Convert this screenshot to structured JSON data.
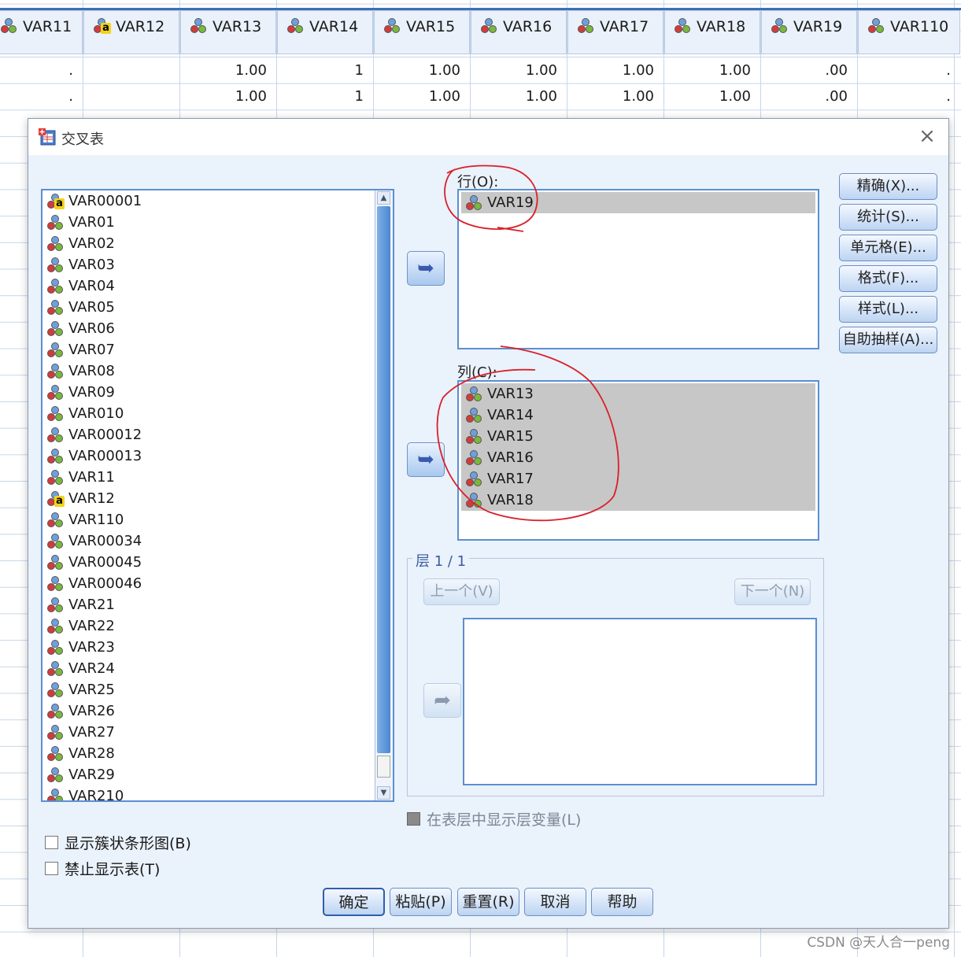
{
  "spreadsheet": {
    "columns": [
      "VAR11",
      "VAR12",
      "VAR13",
      "VAR14",
      "VAR15",
      "VAR16",
      "VAR17",
      "VAR18",
      "VAR19",
      "VAR110"
    ],
    "column_types": [
      "numeric",
      "string",
      "numeric",
      "numeric",
      "numeric",
      "numeric",
      "numeric",
      "numeric",
      "numeric",
      "numeric"
    ],
    "rows": [
      [
        ".",
        "",
        "1.00",
        "1",
        "1.00",
        "1.00",
        "1.00",
        "1.00",
        ".00",
        "."
      ],
      [
        ".",
        "",
        "1.00",
        "1",
        "1.00",
        "1.00",
        "1.00",
        "1.00",
        ".00",
        "."
      ]
    ]
  },
  "dialog": {
    "title": "交叉表",
    "close_symbol": "×",
    "variables": [
      {
        "label": "VAR00001",
        "type": "string"
      },
      {
        "label": "VAR01",
        "type": "numeric"
      },
      {
        "label": "VAR02",
        "type": "numeric"
      },
      {
        "label": "VAR03",
        "type": "numeric"
      },
      {
        "label": "VAR04",
        "type": "numeric"
      },
      {
        "label": "VAR05",
        "type": "numeric"
      },
      {
        "label": "VAR06",
        "type": "numeric"
      },
      {
        "label": "VAR07",
        "type": "numeric"
      },
      {
        "label": "VAR08",
        "type": "numeric"
      },
      {
        "label": "VAR09",
        "type": "numeric"
      },
      {
        "label": "VAR010",
        "type": "numeric"
      },
      {
        "label": "VAR00012",
        "type": "numeric"
      },
      {
        "label": "VAR00013",
        "type": "numeric"
      },
      {
        "label": "VAR11",
        "type": "numeric"
      },
      {
        "label": "VAR12",
        "type": "string"
      },
      {
        "label": "VAR110",
        "type": "numeric"
      },
      {
        "label": "VAR00034",
        "type": "numeric"
      },
      {
        "label": "VAR00045",
        "type": "numeric"
      },
      {
        "label": "VAR00046",
        "type": "numeric"
      },
      {
        "label": "VAR21",
        "type": "numeric"
      },
      {
        "label": "VAR22",
        "type": "numeric"
      },
      {
        "label": "VAR23",
        "type": "numeric"
      },
      {
        "label": "VAR24",
        "type": "numeric"
      },
      {
        "label": "VAR25",
        "type": "numeric"
      },
      {
        "label": "VAR26",
        "type": "numeric"
      },
      {
        "label": "VAR27",
        "type": "numeric"
      },
      {
        "label": "VAR28",
        "type": "numeric"
      },
      {
        "label": "VAR29",
        "type": "numeric"
      },
      {
        "label": "VAR210",
        "type": "numeric"
      }
    ],
    "rows_label": "行(O):",
    "rows_items": [
      "VAR19"
    ],
    "columns_label": "列(C):",
    "columns_items": [
      "VAR13",
      "VAR14",
      "VAR15",
      "VAR16",
      "VAR17",
      "VAR18"
    ],
    "right_buttons": [
      "精确(X)...",
      "统计(S)...",
      "单元格(E)...",
      "格式(F)...",
      "样式(L)...",
      "自助抽样(A)..."
    ],
    "layer_label": "层 1 / 1",
    "prev_button": "上一个(V)",
    "next_button": "下一个(N)",
    "show_layer_vars_label": "在表层中显示层变量(L)",
    "clustered_bar_label": "显示簇状条形图(B)",
    "suppress_tables_label": "禁止显示表(T)",
    "bottom_buttons": [
      "确定",
      "粘贴(P)",
      "重置(R)",
      "取消",
      "帮助"
    ]
  },
  "watermark": "CSDN @天人合一peng",
  "colors": {
    "annotation": "#d9202a",
    "selected_bg": "#c7c7c7",
    "dialog_bg": "#eaf2fb",
    "list_border": "#5b8fd1"
  }
}
